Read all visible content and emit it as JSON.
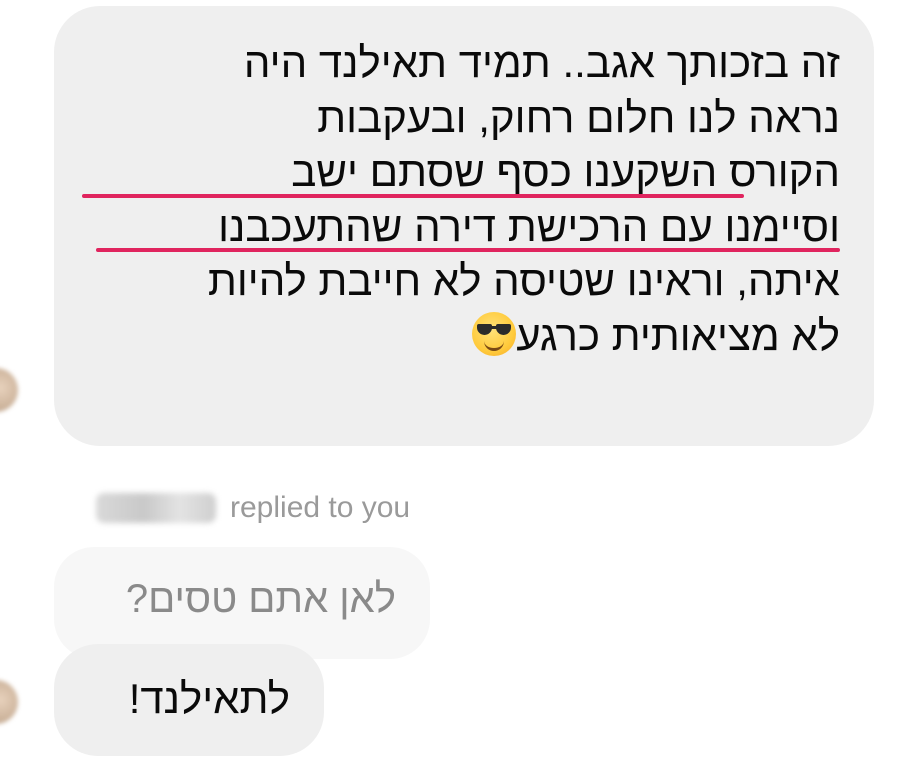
{
  "message_main": {
    "lines": [
      "זה בזכותך אגב.. תמיד תאילנד היה",
      "נראה לנו חלום רחוק, ובעקבות",
      "הקורס השקענו כסף שסתם ישב",
      "וסיימנו עם הרכישת דירה שהתעכבנו",
      "איתה, וראינו שטיסה לא חייבת להיות",
      "לא מציאותית כרגע"
    ],
    "emoji": "smiling-face-with-sunglasses",
    "underline_color": "#e0245e"
  },
  "reply_indicator": {
    "text": "replied to you"
  },
  "quoted_message": {
    "text": "לאן אתם טסים?"
  },
  "reply_message": {
    "text": "לתאילנד!"
  },
  "colors": {
    "bubble": "#efefef",
    "quoted_bubble": "#f7f7f7",
    "quoted_text": "#8a8a8a",
    "meta_text": "#9a9a9a"
  }
}
